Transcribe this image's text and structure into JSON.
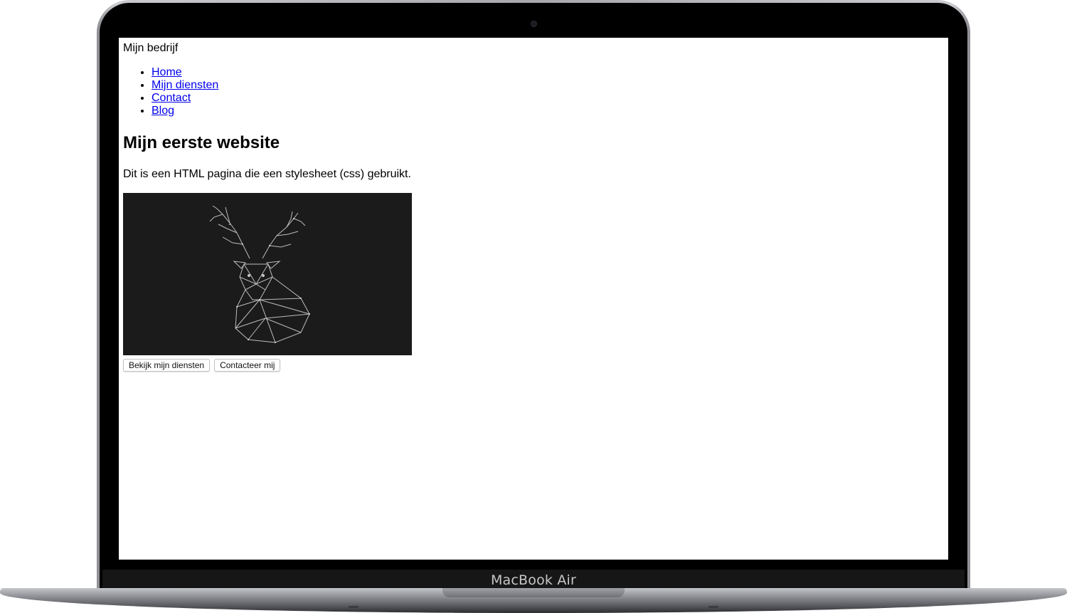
{
  "device": {
    "brand_label": "MacBook Air"
  },
  "site": {
    "name": "Mijn bedrijf",
    "nav": [
      {
        "label": "Home"
      },
      {
        "label": "Mijn diensten"
      },
      {
        "label": "Contact"
      },
      {
        "label": "Blog"
      }
    ],
    "heading": "Mijn eerste website",
    "intro": "Dit is een HTML pagina die een stylesheet (css) gebruikt.",
    "hero_image": {
      "subject": "deer-head-illustration",
      "background": "#1b1b1b"
    },
    "buttons": [
      {
        "label": "Bekijk mijn diensten"
      },
      {
        "label": "Contacteer mij"
      }
    ]
  },
  "colors": {
    "link": "#0000ee",
    "bezel": "#000000",
    "text": "#000000"
  }
}
